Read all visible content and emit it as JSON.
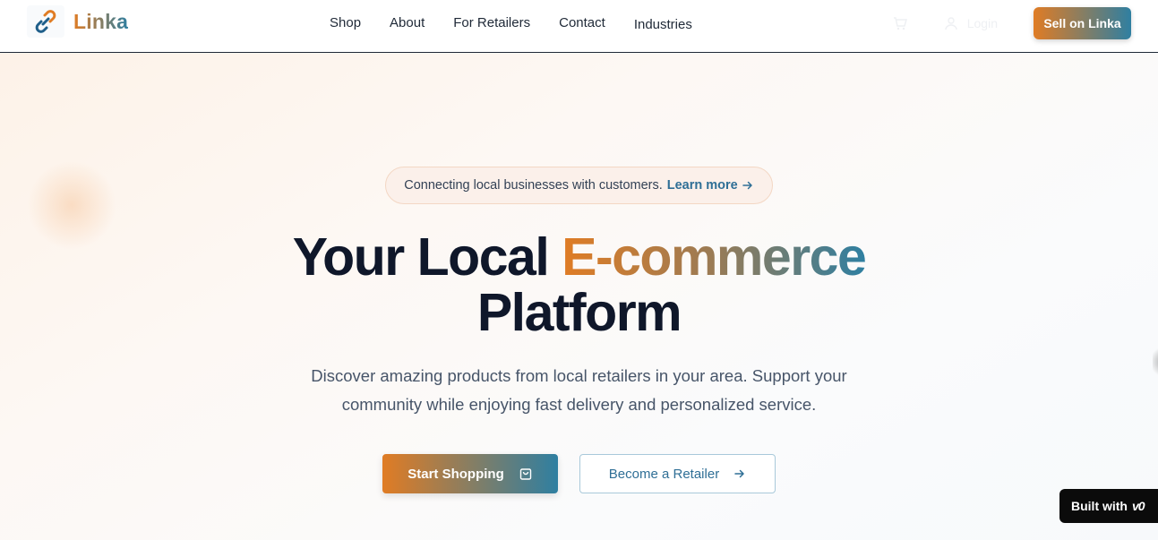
{
  "header": {
    "brand": "Linka",
    "nav": [
      "Shop",
      "About",
      "For Retailers",
      "Contact",
      "Industries"
    ],
    "login_label": "Login",
    "sell_label": "Sell on Linka",
    "icons": [
      "cart-icon",
      "user-icon"
    ]
  },
  "hero": {
    "announcement": "Connecting local businesses with customers.",
    "announcement_link": "Learn more",
    "headline_plain": "Your Local ",
    "headline_gradient": "E-commerce",
    "headline_line2": "Platform",
    "subtitle": "Discover amazing products from local retailers in your area. Support your community while enjoying fast delivery and personalized service.",
    "primary_cta": "Start Shopping",
    "secondary_cta": "Become a Retailer"
  },
  "badge": {
    "label": "Built with",
    "brand": "v0"
  },
  "colors": {
    "accent_orange": "#e07c24",
    "accent_teal": "#2f7fa1",
    "heading": "#0f172a",
    "body_text": "#475569"
  }
}
